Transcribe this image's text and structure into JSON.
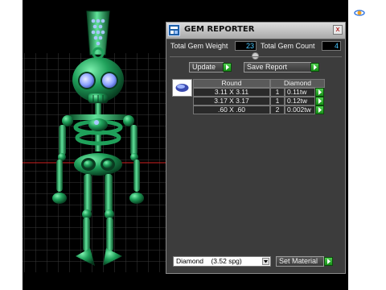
{
  "window": {
    "title": "GEM REPORTER",
    "close_glyph": "x"
  },
  "summary": {
    "weight_label": "Total Gem Weight",
    "weight_value": "23",
    "count_label": "Total Gem Count",
    "count_value": "4"
  },
  "actions": {
    "update_label": "Update",
    "save_report_label": "Save Report"
  },
  "table": {
    "headers": [
      "Round",
      "Diamond"
    ],
    "rows": [
      {
        "size": "3.11 X 3.11",
        "qty": "1",
        "weight": "0.11tw"
      },
      {
        "size": "3.17 X 3.17",
        "qty": "1",
        "weight": "0.12tw"
      },
      {
        "size": ".60 X .60",
        "qty": "2",
        "weight": "0.002tw"
      }
    ]
  },
  "material": {
    "selected": "Diamond    (3.52 spg)",
    "set_label": "Set Material"
  },
  "icons": {
    "window_logo": "gem-reporter-logo-icon",
    "gem": "round-gem-icon",
    "corner": "orbit-icon",
    "go": "green-arrow-icon"
  },
  "colors": {
    "panel_bg": "#3c3c3c",
    "value_text": "#49c8ff",
    "model_green": "#1fa05a",
    "grid_line": "#3a3a3a",
    "axis_red": "#d02020"
  }
}
